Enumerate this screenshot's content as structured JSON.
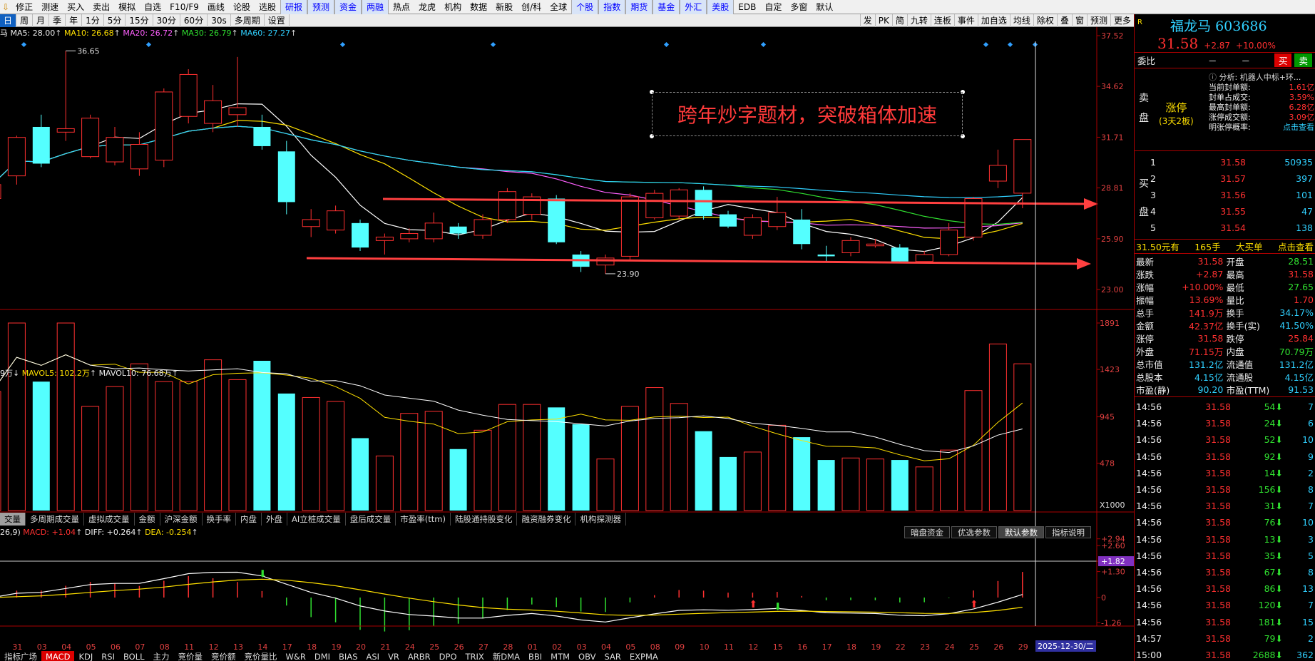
{
  "toolbar": [
    {
      "label": "修正",
      "blue": false
    },
    {
      "label": "测速",
      "blue": false
    },
    {
      "label": "买入",
      "blue": false
    },
    {
      "label": "卖出",
      "blue": false
    },
    {
      "label": "模拟",
      "blue": false
    },
    {
      "label": "自选",
      "blue": false
    },
    {
      "label": "F10/F9",
      "blue": false
    },
    {
      "label": "画线",
      "blue": false
    },
    {
      "label": "论股",
      "blue": false
    },
    {
      "label": "选股",
      "blue": false
    },
    {
      "label": "研报",
      "blue": true
    },
    {
      "label": "预测",
      "blue": true
    },
    {
      "label": "资金",
      "blue": true
    },
    {
      "label": "两融",
      "blue": true
    },
    {
      "label": "热点",
      "blue": false
    },
    {
      "label": "龙虎",
      "blue": false
    },
    {
      "label": "机构",
      "blue": false
    },
    {
      "label": "数据",
      "blue": false
    },
    {
      "label": "新股",
      "blue": false
    },
    {
      "label": "创/科",
      "blue": false
    },
    {
      "label": "全球",
      "blue": false
    },
    {
      "label": "个股",
      "blue": true
    },
    {
      "label": "指数",
      "blue": true
    },
    {
      "label": "期货",
      "blue": true
    },
    {
      "label": "基金",
      "blue": true
    },
    {
      "label": "外汇",
      "blue": true
    },
    {
      "label": "美股",
      "blue": true
    },
    {
      "label": "EDB",
      "blue": false
    },
    {
      "label": "自定",
      "blue": false
    },
    {
      "label": "多窗",
      "blue": false
    },
    {
      "label": "默认",
      "blue": false
    }
  ],
  "periods": [
    "日",
    "周",
    "月",
    "季",
    "年",
    "1分",
    "5分",
    "15分",
    "30分",
    "60分",
    "30s",
    "多周期",
    "设置"
  ],
  "selected_period": "日",
  "right_tools": [
    "发",
    "PK",
    "简",
    "九转",
    "连板",
    "事件",
    "加自选",
    "均线",
    "除权",
    "叠",
    "窗",
    "预测",
    "更多"
  ],
  "ma_legend": {
    "stock": "马",
    "ma5": "MA5: 28.00",
    "ma10": "MA10: 26.68",
    "ma20": "MA20: 26.72",
    "ma30": "MA30: 26.79",
    "ma60": "MA60: 27.27"
  },
  "annotation": "跨年炒字题材，突破箱体加速",
  "price_axis": [
    "37.52",
    "34.62",
    "31.71",
    "28.81",
    "25.90",
    "23.00"
  ],
  "high_label": "36.65",
  "low_label": "23.90",
  "vol_legend": {
    "cur": "9万↓",
    "mavol5": "MAVOL5: 102.2万",
    "mavol10": "MAVOL10: 76.68万"
  },
  "vol_axis": [
    "1891",
    "1423",
    "945",
    "478",
    "X1000"
  ],
  "vol_tabs": [
    "交量",
    "多周期成交量",
    "虚拟成交量",
    "金额",
    "沪深金额",
    "换手率",
    "内盘",
    "外盘",
    "AI立桩成交量",
    "盘后成交量",
    "市盈率(ttm)",
    "陆股通持股变化",
    "融资融券变化",
    "机构探测器"
  ],
  "macd_legend": {
    "params": "26,9)",
    "macd": "MACD: +1.04",
    "diff": "DIFF: +0.264",
    "dea": "DEA: -0.254"
  },
  "macd_buttons": [
    "暗盘资金",
    "优选参数",
    "默认参数",
    "指标说明"
  ],
  "macd_axis": [
    "2.94",
    "2.60",
    "1.82",
    "1.30",
    "0",
    "-1.26"
  ],
  "dates": [
    "31",
    "03",
    "04",
    "05",
    "06",
    "07",
    "08",
    "11",
    "12",
    "13",
    "14",
    "17",
    "18",
    "19",
    "20",
    "21",
    "24",
    "25",
    "26",
    "27",
    "28",
    "01",
    "02",
    "03",
    "04",
    "05",
    "08",
    "09",
    "10",
    "11",
    "12",
    "15",
    "16",
    "17",
    "18",
    "19",
    "22",
    "23",
    "24",
    "25",
    "26",
    "29"
  ],
  "cur_date": "2025-12-30/二",
  "bottom_tabs": [
    "指标广场",
    "MACD",
    "KDJ",
    "RSI",
    "BOLL",
    "主力",
    "竞价量",
    "竞价额",
    "竞价量比",
    "W&R",
    "DMI",
    "BIAS",
    "ASI",
    "VR",
    "ARBR",
    "DPO",
    "TRIX",
    "新DMA",
    "BBI",
    "MTM",
    "OBV",
    "SAR",
    "EXPMA"
  ],
  "stock": {
    "name": "福龙马",
    "code": "603686",
    "price": "31.58",
    "change": "+2.87",
    "pct": "+10.00%"
  },
  "weibi": {
    "label": "委比",
    "v1": "－",
    "v2": "－",
    "buy": "买",
    "sell": "卖"
  },
  "sell_side": {
    "label1": "卖",
    "label2": "盘",
    "limit": "涨停",
    "limit_sub": "(3天2板)"
  },
  "analysis": {
    "title": "分析: 机器人中标+环...",
    "rows": [
      {
        "k": "当前封单额:",
        "v": "1.61亿"
      },
      {
        "k": "封单占成交:",
        "v": "3.59%"
      },
      {
        "k": "最高封单额:",
        "v": "6.28亿"
      },
      {
        "k": "涨停成交额:",
        "v": "3.09亿"
      },
      {
        "k": "明张停概率:",
        "v": "点击查看"
      }
    ]
  },
  "buy_side": {
    "label1": "买",
    "label2": "盘"
  },
  "bids": [
    {
      "n": "1",
      "p": "31.58",
      "v": "50935"
    },
    {
      "n": "2",
      "p": "31.57",
      "v": "397"
    },
    {
      "n": "3",
      "p": "31.56",
      "v": "101"
    },
    {
      "n": "4",
      "p": "31.55",
      "v": "47"
    },
    {
      "n": "5",
      "p": "31.54",
      "v": "138"
    }
  ],
  "deal_line": {
    "price": "31.50元有",
    "hands": "165手",
    "type": "大买单",
    "link": "点击查看"
  },
  "quote": [
    {
      "k1": "最新",
      "v1": "31.58",
      "k2": "开盘",
      "v2": "28.51"
    },
    {
      "k1": "涨跌",
      "v1": "+2.87",
      "k2": "最高",
      "v2": "31.58"
    },
    {
      "k1": "涨幅",
      "v1": "+10.00%",
      "k2": "最低",
      "v2": "27.65"
    },
    {
      "k1": "振幅",
      "v1": "13.69%",
      "k2": "量比",
      "v2": "1.70"
    },
    {
      "k1": "总手",
      "v1": "141.9万",
      "k2": "换手",
      "v2": "34.17%"
    },
    {
      "k1": "金额",
      "v1": "42.37亿",
      "k2": "换手(实)",
      "v2": "41.50%"
    },
    {
      "k1": "涨停",
      "v1": "31.58",
      "k2": "跌停",
      "v2": "25.84"
    },
    {
      "k1": "外盘",
      "v1": "71.15万",
      "k2": "内盘",
      "v2": "70.79万"
    },
    {
      "k1": "总市值",
      "v1": "131.2亿",
      "k2": "流通值",
      "v2": "131.2亿"
    },
    {
      "k1": "总股本",
      "v1": "4.15亿",
      "k2": "流通股",
      "v2": "4.15亿"
    },
    {
      "k1": "市盈(静)",
      "v1": "90.20",
      "k2": "市盈(TTM)",
      "v2": "91.53"
    }
  ],
  "ticks": [
    {
      "t": "14:56",
      "p": "31.58",
      "v": "54",
      "n": "7"
    },
    {
      "t": "14:56",
      "p": "31.58",
      "v": "24",
      "n": "6"
    },
    {
      "t": "14:56",
      "p": "31.58",
      "v": "52",
      "n": "10"
    },
    {
      "t": "14:56",
      "p": "31.58",
      "v": "92",
      "n": "9"
    },
    {
      "t": "14:56",
      "p": "31.58",
      "v": "14",
      "n": "2"
    },
    {
      "t": "14:56",
      "p": "31.58",
      "v": "156",
      "n": "8"
    },
    {
      "t": "14:56",
      "p": "31.58",
      "v": "31",
      "n": "7"
    },
    {
      "t": "14:56",
      "p": "31.58",
      "v": "76",
      "n": "10"
    },
    {
      "t": "14:56",
      "p": "31.58",
      "v": "13",
      "n": "3"
    },
    {
      "t": "14:56",
      "p": "31.58",
      "v": "35",
      "n": "5"
    },
    {
      "t": "14:56",
      "p": "31.58",
      "v": "67",
      "n": "8"
    },
    {
      "t": "14:56",
      "p": "31.58",
      "v": "86",
      "n": "13"
    },
    {
      "t": "14:56",
      "p": "31.58",
      "v": "120",
      "n": "7"
    },
    {
      "t": "14:56",
      "p": "31.58",
      "v": "181",
      "n": "15"
    },
    {
      "t": "14:57",
      "p": "31.58",
      "v": "79",
      "n": "2"
    },
    {
      "t": "15:00",
      "p": "31.58",
      "v": "2688",
      "n": "362"
    }
  ],
  "candles": [
    {
      "o": 28.2,
      "h": 29.5,
      "l": 27.5,
      "c": 29.0
    },
    {
      "o": 29.5,
      "h": 31.8,
      "l": 29.0,
      "c": 31.7
    },
    {
      "o": 32.3,
      "h": 33.0,
      "l": 30.0,
      "c": 30.2
    },
    {
      "o": 32.0,
      "h": 36.65,
      "l": 31.5,
      "c": 32.2
    },
    {
      "o": 30.6,
      "h": 33.0,
      "l": 30.5,
      "c": 32.8
    },
    {
      "o": 30.3,
      "h": 32.3,
      "l": 30.1,
      "c": 31.7
    },
    {
      "o": 29.9,
      "h": 32.0,
      "l": 29.5,
      "c": 31.3
    },
    {
      "o": 30.4,
      "h": 34.5,
      "l": 30.0,
      "c": 34.3
    },
    {
      "o": 32.9,
      "h": 35.6,
      "l": 32.5,
      "c": 35.3
    },
    {
      "o": 32.5,
      "h": 34.7,
      "l": 32.0,
      "c": 33.8
    },
    {
      "o": 33.0,
      "h": 36.3,
      "l": 32.3,
      "c": 33.4
    },
    {
      "o": 32.3,
      "h": 33.0,
      "l": 31.0,
      "c": 31.2
    },
    {
      "o": 30.9,
      "h": 31.5,
      "l": 27.3,
      "c": 28.0
    },
    {
      "o": 26.6,
      "h": 27.6,
      "l": 26.0,
      "c": 27.0
    },
    {
      "o": 26.4,
      "h": 27.8,
      "l": 26.2,
      "c": 27.5
    },
    {
      "o": 26.8,
      "h": 27.0,
      "l": 25.2,
      "c": 25.4
    },
    {
      "o": 25.8,
      "h": 26.2,
      "l": 25.0,
      "c": 26.0
    },
    {
      "o": 25.9,
      "h": 26.5,
      "l": 25.7,
      "c": 26.2
    },
    {
      "o": 25.9,
      "h": 27.4,
      "l": 25.7,
      "c": 26.8
    },
    {
      "o": 26.6,
      "h": 26.8,
      "l": 25.9,
      "c": 26.2
    },
    {
      "o": 26.1,
      "h": 27.3,
      "l": 25.9,
      "c": 27.0
    },
    {
      "o": 27.0,
      "h": 28.8,
      "l": 26.8,
      "c": 28.6
    },
    {
      "o": 27.3,
      "h": 28.5,
      "l": 27.0,
      "c": 28.3
    },
    {
      "o": 28.2,
      "h": 28.4,
      "l": 25.6,
      "c": 25.7
    },
    {
      "o": 25.0,
      "h": 25.2,
      "l": 24.0,
      "c": 24.3
    },
    {
      "o": 24.4,
      "h": 25.0,
      "l": 23.9,
      "c": 24.8
    },
    {
      "o": 24.9,
      "h": 28.5,
      "l": 24.7,
      "c": 28.3
    },
    {
      "o": 27.1,
      "h": 28.7,
      "l": 27.0,
      "c": 28.5
    },
    {
      "o": 27.2,
      "h": 28.8,
      "l": 27.0,
      "c": 28.7
    },
    {
      "o": 28.7,
      "h": 28.9,
      "l": 27.0,
      "c": 27.2
    },
    {
      "o": 27.3,
      "h": 27.5,
      "l": 26.5,
      "c": 26.6
    },
    {
      "o": 26.1,
      "h": 27.3,
      "l": 25.9,
      "c": 27.1
    },
    {
      "o": 26.6,
      "h": 28.3,
      "l": 26.4,
      "c": 27.4
    },
    {
      "o": 27.0,
      "h": 27.6,
      "l": 25.3,
      "c": 25.6
    },
    {
      "o": 25.0,
      "h": 25.5,
      "l": 24.6,
      "c": 24.9
    },
    {
      "o": 25.1,
      "h": 26.0,
      "l": 24.9,
      "c": 25.8
    },
    {
      "o": 25.5,
      "h": 25.9,
      "l": 25.4,
      "c": 25.6
    },
    {
      "o": 25.4,
      "h": 25.6,
      "l": 24.5,
      "c": 24.6
    },
    {
      "o": 24.6,
      "h": 25.2,
      "l": 24.5,
      "c": 25.0
    },
    {
      "o": 25.0,
      "h": 26.8,
      "l": 24.9,
      "c": 26.4
    },
    {
      "o": 26.0,
      "h": 28.3,
      "l": 25.8,
      "c": 28.2
    },
    {
      "o": 29.2,
      "h": 31.0,
      "l": 28.8,
      "c": 30.1
    },
    {
      "o": 28.51,
      "h": 31.58,
      "l": 27.65,
      "c": 31.58
    }
  ],
  "volumes": [
    1200,
    1891,
    1300,
    1891,
    1050,
    1250,
    1480,
    1300,
    1300,
    1520,
    1320,
    1510,
    1180,
    1140,
    1100,
    730,
    550,
    980,
    1000,
    620,
    810,
    1070,
    1070,
    1040,
    870,
    520,
    1050,
    1240,
    1080,
    800,
    540,
    590,
    860,
    740,
    510,
    530,
    520,
    510,
    440,
    610,
    1210,
    1680,
    1480
  ]
}
